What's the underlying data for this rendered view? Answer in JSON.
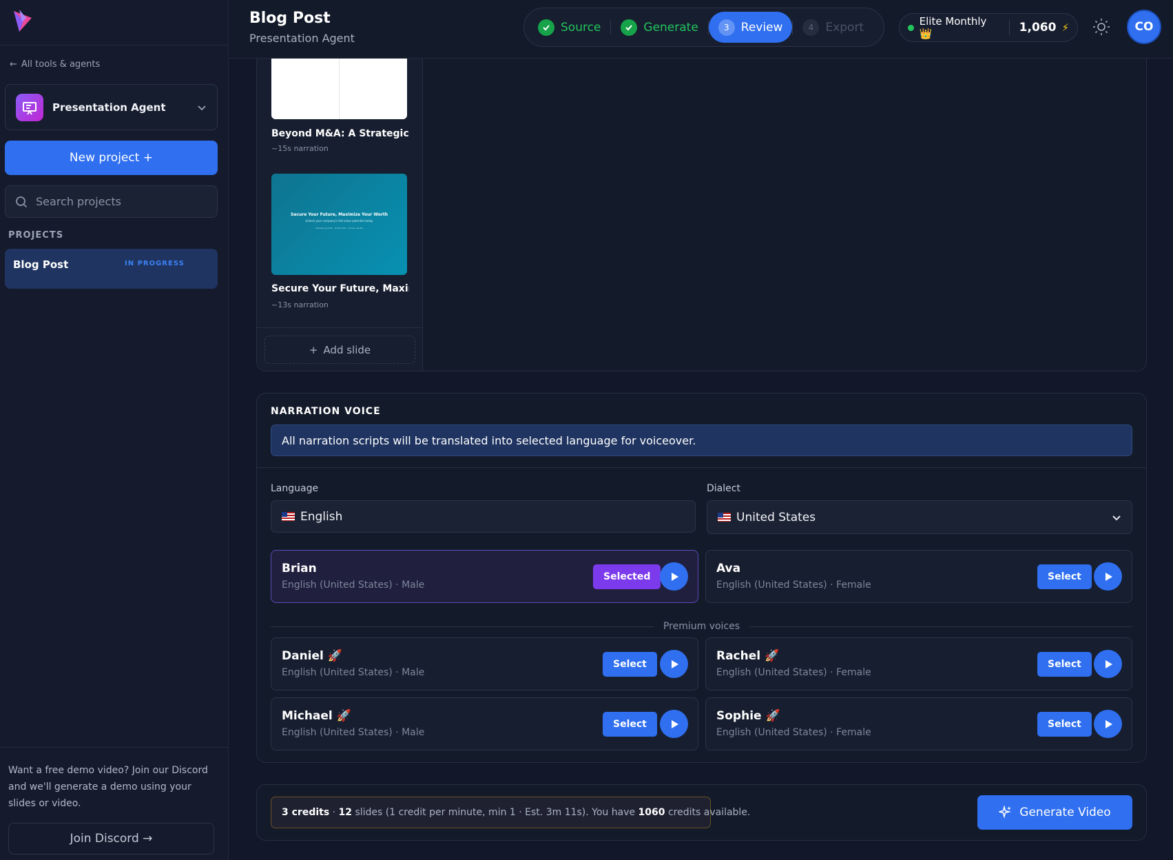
{
  "sidebar": {
    "back_link": "All tools & agents",
    "agent_name": "Presentation Agent",
    "new_project": "New project +",
    "search_placeholder": "Search projects",
    "projects_label": "PROJECTS",
    "project": {
      "name": "Blog Post",
      "status": "IN PROGRESS"
    },
    "discord_text": "Want a free demo video? Join our Discord and we'll generate a demo using your slides or video.",
    "discord_button": "Join Discord →"
  },
  "header": {
    "title": "Blog Post",
    "subtitle": "Presentation Agent",
    "steps": [
      {
        "num": "✓",
        "label": "Source"
      },
      {
        "num": "✓",
        "label": "Generate"
      },
      {
        "num": "3",
        "label": "Review"
      },
      {
        "num": "4",
        "label": "Export"
      }
    ],
    "plan": "Elite Monthly 👑",
    "credits": "1,060",
    "bolt": "⚡",
    "avatar": "CO"
  },
  "slides": [
    {
      "title": "Beyond M&A: A Strategic I...",
      "duration": "~15s narration"
    },
    {
      "title": "Secure Your Future, Maxim...",
      "duration": "~13s narration",
      "thumb_title": "Secure Your Future, Maximize Your Worth",
      "thumb_sub": "Unlock your company's full value potential today",
      "thumb_lines": "Strategic growth · Smart exits · Proven results"
    }
  ],
  "add_slide": "Add slide",
  "narration": {
    "title": "NARRATION VOICE",
    "info": "All narration scripts will be translated into selected language for voiceover.",
    "language_label": "Language",
    "language_value": "English",
    "dialect_label": "Dialect",
    "dialect_value": "United States",
    "premium_label": "Premium voices",
    "voices": [
      {
        "name": "Brian",
        "desc": "English (United States) · Male",
        "button": "Selected"
      },
      {
        "name": "Ava",
        "desc": "English (United States) · Female",
        "button": "Select"
      },
      {
        "name": "Daniel 🚀",
        "desc": "English (United States) · Male",
        "button": "Select"
      },
      {
        "name": "Rachel 🚀",
        "desc": "English (United States) · Female",
        "button": "Select"
      },
      {
        "name": "Michael 🚀",
        "desc": "English (United States) · Male",
        "button": "Select"
      },
      {
        "name": "Sophie 🚀",
        "desc": "English (United States) · Female",
        "button": "Select"
      }
    ]
  },
  "footer": {
    "credits": "3 credits",
    "sep1": " · ",
    "slides_count": "12",
    "slides_text": " slides (1 credit per minute, min 1 · Est. 3m 11s). You have ",
    "available": "1060",
    "available_text": " credits available.",
    "generate": "Generate Video"
  },
  "colors": {
    "accent": "#2f6ff0",
    "success": "#22c55e",
    "selected": "#7c3aed"
  }
}
